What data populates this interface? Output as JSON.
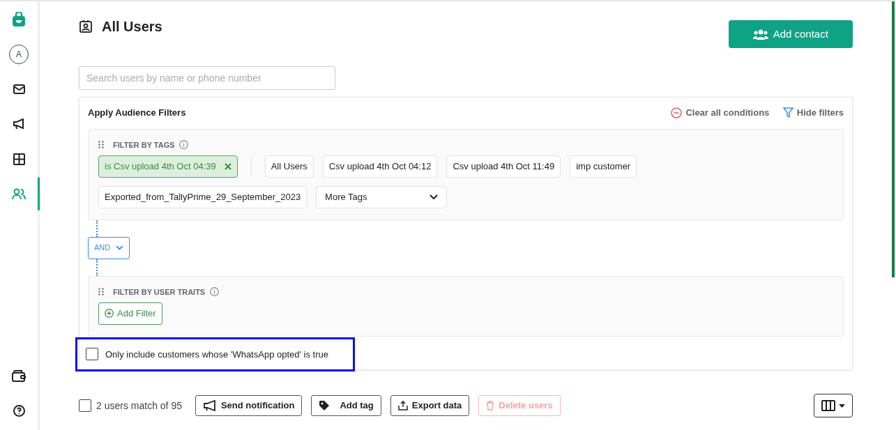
{
  "sidebar": {
    "logo": true,
    "top_items": [
      {
        "kind": "avatar",
        "text": "A",
        "selected": false
      },
      {
        "kind": "mail",
        "selected": false
      },
      {
        "kind": "megaphone",
        "selected": false
      },
      {
        "kind": "grid",
        "selected": false
      },
      {
        "kind": "users",
        "selected": true
      }
    ],
    "bottom_items": [
      {
        "kind": "wallet",
        "selected": false
      },
      {
        "kind": "help",
        "selected": false
      }
    ]
  },
  "header": {
    "title": "All Users",
    "add_button": "Add contact"
  },
  "search": {
    "placeholder": "Search users by name or phone number"
  },
  "filters": {
    "title": "Apply Audience Filters",
    "clear": "Clear all conditions",
    "hide": "Hide filters",
    "tags_section": {
      "label": "FILTER BY TAGS",
      "tags": [
        {
          "label": "is Csv upload 4th Oct 04:39",
          "selected": true
        },
        {
          "label": "All Users",
          "selected": false
        },
        {
          "label": "Csv upload 4th Oct 04:12",
          "selected": false
        },
        {
          "label": "Csv upload 4th Oct 11:49",
          "selected": false
        },
        {
          "label": "imp customer",
          "selected": false
        },
        {
          "label": "Exported_from_TallyPrime_29_September_2023",
          "selected": false
        }
      ],
      "more": "More Tags"
    },
    "operator": "AND",
    "traits_section": {
      "label": "FILTER BY USER TRAITS",
      "add_button": "Add Filter"
    },
    "whatsapp_option": {
      "label": "Only include customers whose 'WhatsApp opted' is true",
      "checked": false,
      "highlighted": true
    }
  },
  "bulk_bar": {
    "select_all_checked": false,
    "count": "2 users match of 95",
    "actions": [
      {
        "kind": "megaphone",
        "label": "Send notification",
        "disabled": false
      },
      {
        "kind": "tag",
        "label": "Add tag",
        "disabled": false
      },
      {
        "kind": "export",
        "label": "Export data",
        "disabled": false
      },
      {
        "kind": "trash",
        "label": "Delete users",
        "disabled": true
      }
    ]
  }
}
